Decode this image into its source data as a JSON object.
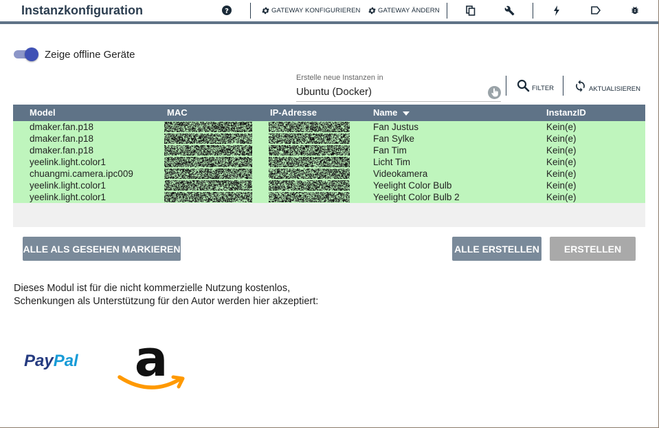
{
  "header": {
    "title": "Instanzkonfiguration",
    "configure_gateway": "GATEWAY KONFIGURIEREN",
    "change_gateway": "GATEWAY ÄNDERN"
  },
  "toggle": {
    "label": "Zeige offline Geräte",
    "checked": true
  },
  "instance_select": {
    "label": "Erstelle neue Instanzen in",
    "value": "Ubuntu (Docker)"
  },
  "toolbar": {
    "filter": "FILTER",
    "refresh": "AKTUALISIEREN"
  },
  "table": {
    "headers": {
      "model": "Model",
      "mac": "MAC",
      "ip": "IP-Adresse",
      "name": "Name",
      "instance": "InstanzID"
    },
    "rows": [
      {
        "model": "dmaker.fan.p18",
        "name": "Fan Justus",
        "instance": "Kein(e)"
      },
      {
        "model": "dmaker.fan.p18",
        "name": "Fan Sylke",
        "instance": "Kein(e)"
      },
      {
        "model": "dmaker.fan.p18",
        "name": "Fan Tim",
        "instance": "Kein(e)"
      },
      {
        "model": "yeelink.light.color1",
        "name": "Licht Tim",
        "instance": "Kein(e)"
      },
      {
        "model": "chuangmi.camera.ipc009",
        "name": "Videokamera",
        "instance": "Kein(e)"
      },
      {
        "model": "yeelink.light.color1",
        "name": "Yeelight Color Bulb",
        "instance": "Kein(e)"
      },
      {
        "model": "yeelink.light.color1",
        "name": "Yeelight Color Bulb 2",
        "instance": "Kein(e)"
      }
    ]
  },
  "buttons": {
    "mark_all_seen": "ALLE ALS GESEHEN MARKIEREN",
    "create_all": "ALLE ERSTELLEN",
    "create": "ERSTELLEN"
  },
  "info": {
    "line1": "Dieses Modul ist für die nicht kommerzielle Nutzung kostenlos,",
    "line2": "Schenkungen als Unterstützung für den Autor werden hier akzeptiert:"
  },
  "donate": {
    "paypal_text": "PayPal",
    "amazon_text": "a"
  },
  "colors": {
    "header_bar": "#5f7387",
    "row_bg": "#bff5bd",
    "button_active": "#7a8a9a",
    "button_disabled": "#a9a9a9",
    "toggle_accent": "#3f51b5",
    "paypal_dark": "#253b80",
    "paypal_light": "#179bd7",
    "amazon_orange": "#ff9900"
  },
  "icons": {
    "help": "help-circle-icon",
    "gateway_settings": "gear-icon",
    "copy": "copy-icon",
    "tools": "wrench-icon",
    "flash": "lightning-icon",
    "label": "tag-icon",
    "debug": "bug-icon",
    "search": "search-icon",
    "refresh": "refresh-icon"
  }
}
